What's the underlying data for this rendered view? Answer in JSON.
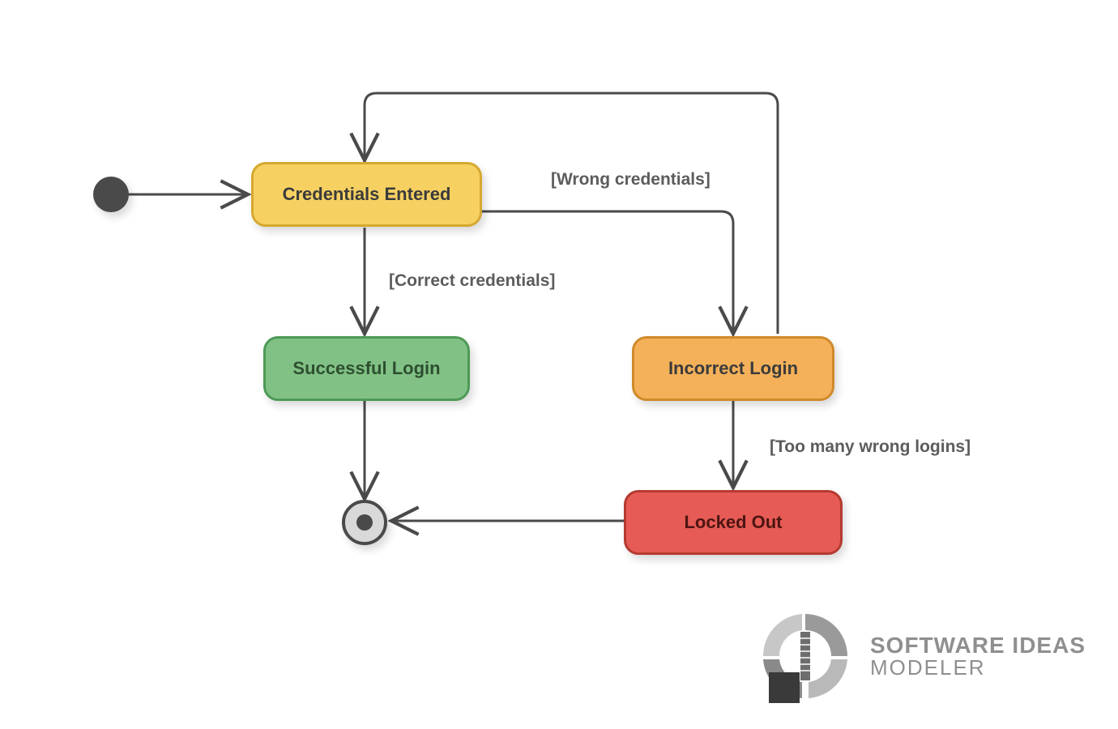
{
  "states": {
    "credentials": "Credentials Entered",
    "success": "Successful Login",
    "incorrect": "Incorrect Login",
    "locked": "Locked Out"
  },
  "guards": {
    "wrong": "[Wrong credentials]",
    "correct": "[Correct credentials]",
    "toomany": "[Too many wrong logins]"
  },
  "logo": {
    "line1": "SOFTWARE IDEAS",
    "line2": "MODELER"
  },
  "chart_data": {
    "type": "state_machine",
    "title": "Login State Machine",
    "initial_state": "InitialPseudoState",
    "final_state": "FinalState",
    "states": [
      {
        "id": "credentials",
        "name": "Credentials Entered",
        "color": "#f6d162"
      },
      {
        "id": "success",
        "name": "Successful Login",
        "color": "#82c186"
      },
      {
        "id": "incorrect",
        "name": "Incorrect Login",
        "color": "#f4b15a"
      },
      {
        "id": "locked",
        "name": "Locked Out",
        "color": "#e65b55"
      }
    ],
    "transitions": [
      {
        "from": "InitialPseudoState",
        "to": "credentials",
        "guard": null
      },
      {
        "from": "credentials",
        "to": "success",
        "guard": "Correct credentials"
      },
      {
        "from": "credentials",
        "to": "incorrect",
        "guard": "Wrong credentials"
      },
      {
        "from": "incorrect",
        "to": "credentials",
        "guard": null
      },
      {
        "from": "incorrect",
        "to": "locked",
        "guard": "Too many wrong logins"
      },
      {
        "from": "success",
        "to": "FinalState",
        "guard": null
      },
      {
        "from": "locked",
        "to": "FinalState",
        "guard": null
      }
    ]
  }
}
